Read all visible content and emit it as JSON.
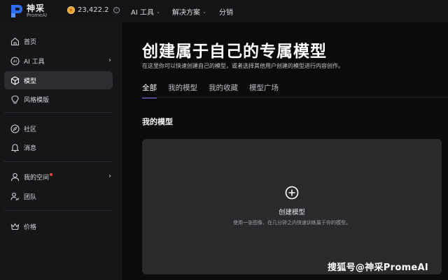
{
  "brand": {
    "name_cn": "神采",
    "name_en": "PromeAI"
  },
  "header": {
    "credits": "23,422.2",
    "nav": [
      {
        "label": "AI 工具",
        "has_dropdown": true
      },
      {
        "label": "解决方案",
        "has_dropdown": true
      },
      {
        "label": "分销",
        "has_dropdown": false
      }
    ]
  },
  "sidebar": {
    "items": [
      {
        "label": "首页",
        "icon": "home-icon"
      },
      {
        "label": "AI 工具",
        "icon": "ai-icon"
      },
      {
        "label": "模型",
        "icon": "cube-icon",
        "active": true
      },
      {
        "label": "风格模版",
        "icon": "bulb-icon"
      },
      {
        "label": "社区",
        "icon": "compass-icon"
      },
      {
        "label": "消息",
        "icon": "bell-icon"
      },
      {
        "label": "我的空间",
        "icon": "user-icon"
      },
      {
        "label": "团队",
        "icon": "team-icon"
      },
      {
        "label": "价格",
        "icon": "crown-icon"
      }
    ]
  },
  "main": {
    "title": "创建属于自己的专属模型",
    "subtitle": "在这里你可以快速创建自己的模型，或者选择其他用户创建的模型进行内容创作。",
    "tabs": [
      "全部",
      "我的模型",
      "我的收藏",
      "模型广场"
    ],
    "active_tab": "全部",
    "section_title": "我的模型",
    "create_card": {
      "label": "创建模型",
      "description": "使用一张图像、在几分钟之内快速训练属于你的模型。"
    }
  },
  "watermark": "搜狐号@神采PromeAI",
  "colors": {
    "accent": "#7b6cf5",
    "sidebar_bg": "#161618",
    "main_bg": "#0b0b0c",
    "card_bg": "#2a2a2d"
  }
}
